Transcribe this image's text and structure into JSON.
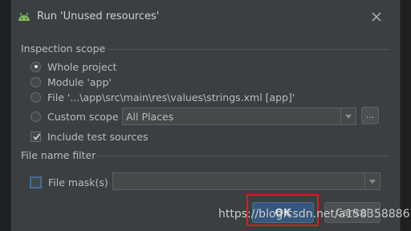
{
  "dialog": {
    "title": "Run 'Unused resources'",
    "close_icon": "close-icon",
    "app_icon": "android-icon"
  },
  "inspection_scope": {
    "header": "Inspection scope",
    "options": [
      {
        "label": "Whole project",
        "selected": true
      },
      {
        "label": "Module 'app'",
        "selected": false
      },
      {
        "label": "File '...\\app\\src\\main\\res\\values\\strings.xml [app]'",
        "selected": false
      },
      {
        "label": "Custom scope",
        "selected": false
      }
    ],
    "custom_scope_value": "All Places",
    "custom_scope_more": "...",
    "include_test_sources": {
      "label": "Include test sources",
      "checked": true
    }
  },
  "file_name_filter": {
    "header": "File name filter",
    "file_mask": {
      "label": "File mask(s)",
      "checked": false,
      "value": ""
    }
  },
  "buttons": {
    "ok": "OK",
    "cancel": "Cancel"
  },
  "watermark": "https://blog.csdn.net/a1583588867",
  "colors": {
    "background": "#3c3f41",
    "ok_button": "#365880",
    "highlight_box": "#e8141e"
  }
}
